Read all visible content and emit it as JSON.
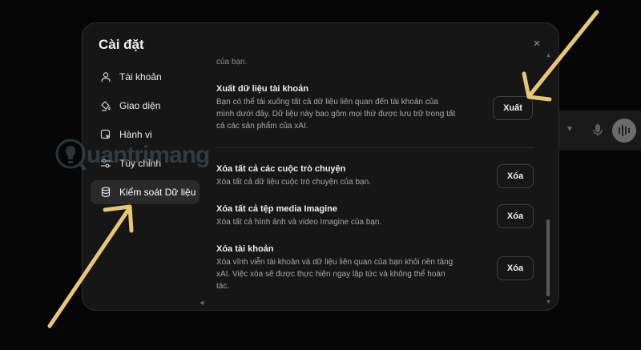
{
  "dialog": {
    "title": "Cài đặt",
    "close_label": "×"
  },
  "nav": {
    "items": [
      {
        "label": "Tài khoản"
      },
      {
        "label": "Giao diện"
      },
      {
        "label": "Hành vi"
      },
      {
        "label": "Tùy chỉnh"
      },
      {
        "label": "Kiểm soát Dữ liệu"
      }
    ]
  },
  "content": {
    "cut_text": "của bạn.",
    "rows": [
      {
        "title": "Xuất dữ liệu tài khoản",
        "desc": "Bạn có thể tải xuống tất cả dữ liệu liên quan đến tài khoản của mình dưới đây. Dữ liệu này bao gồm mọi thứ được lưu trữ trong tất cả các sản phẩm của xAI.",
        "button": "Xuất"
      },
      {
        "title": "Xóa tất cả các cuộc trò chuyện",
        "desc": "Xóa tất cả dữ liệu cuộc trò chuyện của bạn.",
        "button": "Xóa"
      },
      {
        "title": "Xóa tất cả tệp media Imagine",
        "desc": "Xóa tất cả hình ảnh và video Imagine của bạn.",
        "button": "Xóa"
      },
      {
        "title": "Xóa tài khoản",
        "desc": "Xóa vĩnh viễn tài khoản và dữ liệu liên quan của bạn khỏi nền tảng xAI. Việc xóa sẽ được thực hiện ngay lập tức và không thể hoàn tác.",
        "button": "Xóa"
      }
    ]
  },
  "watermark": {
    "text": "uantrimang"
  },
  "colors": {
    "arrow": "#e7c774",
    "dialog_bg": "#161616",
    "active_nav_bg": "#2a2a2a"
  },
  "icons": [
    "person-icon",
    "paint-bucket-icon",
    "behavior-icon",
    "customize-icon",
    "database-icon",
    "close-icon"
  ]
}
